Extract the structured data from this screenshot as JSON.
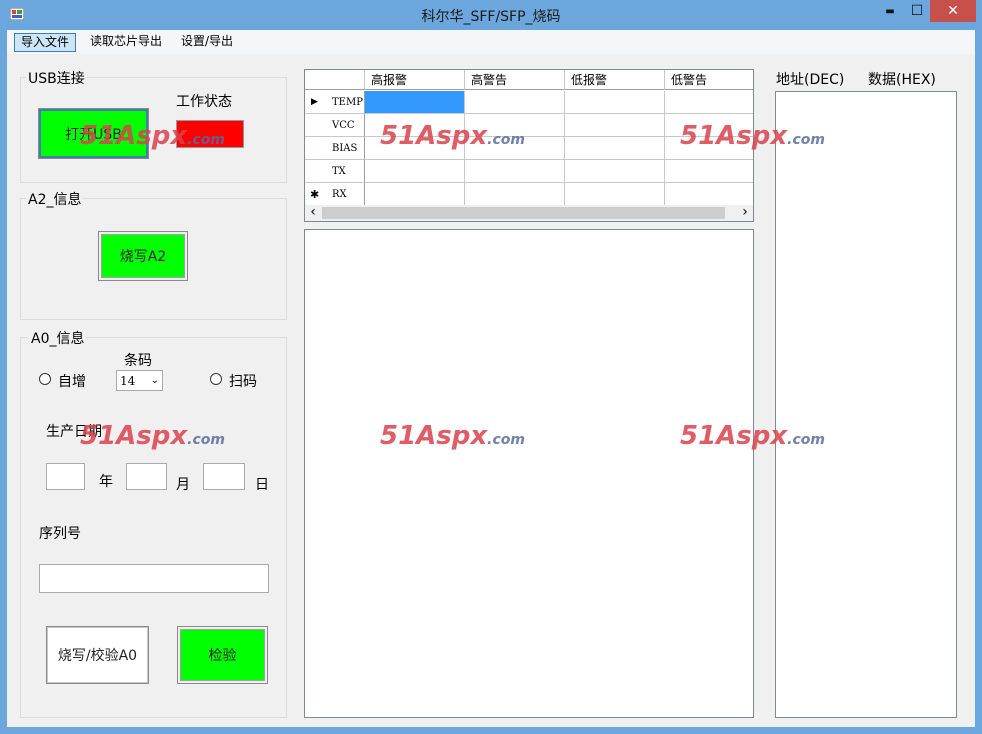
{
  "window": {
    "title": "科尔华_SFF/SFP_烧码",
    "min": "▬",
    "max": "☐",
    "close": "✕"
  },
  "menu": {
    "import": "导入文件",
    "read_export": "读取芯片导出",
    "settings": "设置/导出"
  },
  "usb": {
    "group_label": "USB连接",
    "open_button": "打开USB",
    "status_label": "工作状态",
    "status_color": "#ff0000"
  },
  "a2": {
    "group_label": "A2_信息",
    "write_button": "烧写A2"
  },
  "a0": {
    "group_label": "A0_信息",
    "barcode_label": "条码",
    "radio_auto": "自增",
    "radio_scan": "扫码",
    "barcode_value": "14",
    "date_label": "生产日期",
    "year": "年",
    "month": "月",
    "day": "日",
    "serial_label": "序列号",
    "write_verify_button": "烧写/校验A0",
    "verify_button": "检验"
  },
  "grid": {
    "columns": [
      "高报警",
      "高警告",
      "低报警",
      "低警告"
    ],
    "rows": [
      "TEMP",
      "VCC",
      "BIAS",
      "TX",
      "RX"
    ],
    "current_row_marker": "▶",
    "new_row_marker": "✱",
    "scroll_left": "‹",
    "scroll_right": "›",
    "selected_color": "#3399ff"
  },
  "right_panel": {
    "address_label": "地址(DEC)",
    "data_label": "数据(HEX)"
  },
  "watermark": {
    "text": "51Aspx",
    "suffix": ".com"
  }
}
